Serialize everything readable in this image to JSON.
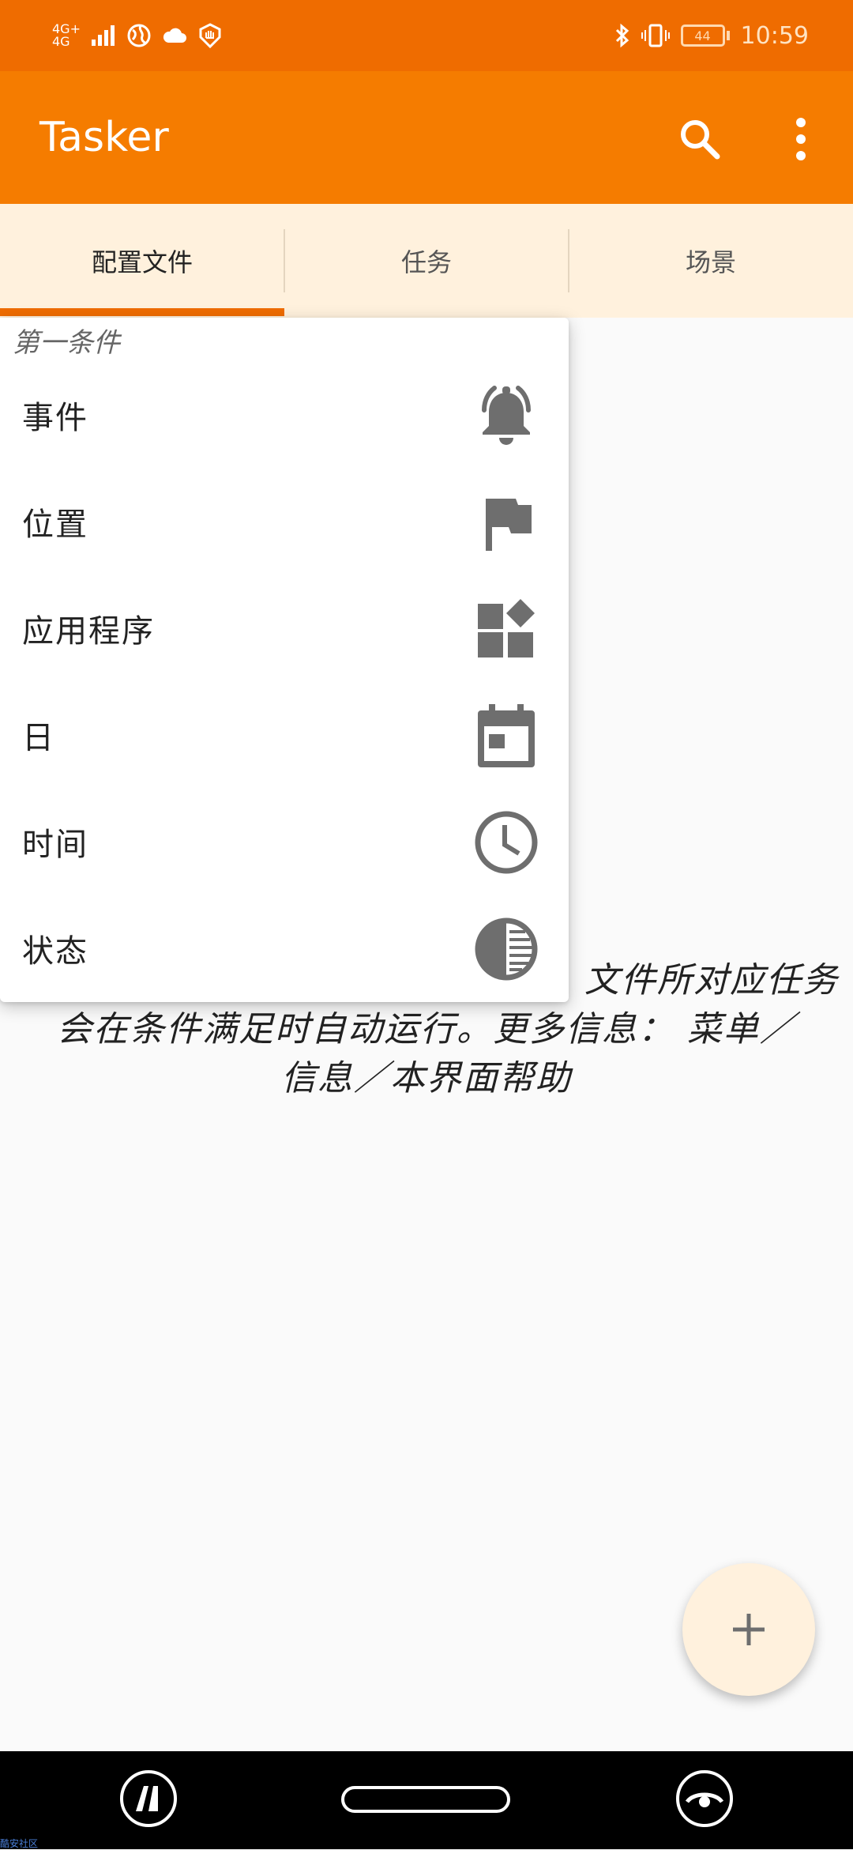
{
  "status_bar": {
    "network_top": "4G+",
    "network_bottom": "4G",
    "battery": "44",
    "time": "10:59"
  },
  "app_bar": {
    "title": "Tasker",
    "search_icon": "search-icon",
    "more_icon": "more-vert-icon"
  },
  "tabs": [
    {
      "label": "配置文件",
      "active": true
    },
    {
      "label": "任务",
      "active": false
    },
    {
      "label": "场景",
      "active": false
    }
  ],
  "empty_message": {
    "line1": "文件所对应任务",
    "line2": "会在条件满足时自动运行。更多信息： 菜单／",
    "line3": "信息／本界面帮助"
  },
  "popup": {
    "title": "第一条件",
    "items": [
      {
        "label": "事件",
        "icon": "bell-icon"
      },
      {
        "label": "位置",
        "icon": "flag-icon"
      },
      {
        "label": "应用程序",
        "icon": "apps-icon"
      },
      {
        "label": "日",
        "icon": "calendar-icon"
      },
      {
        "label": "时间",
        "icon": "clock-icon"
      },
      {
        "label": "状态",
        "icon": "half-circle-icon"
      }
    ]
  },
  "fab": {
    "icon": "plus-icon"
  },
  "nav_bar": {
    "left_icon": "assistant-icon",
    "home_icon": "home-pill-icon",
    "right_icon": "eye-icon"
  },
  "watermark": "酷安社区",
  "colors": {
    "status_bar": "#ef6c00",
    "app_bar": "#f57c00",
    "tab_background": "#fff1dd",
    "indicator": "#ef6c00",
    "icon_gray": "#6e6e6e"
  }
}
